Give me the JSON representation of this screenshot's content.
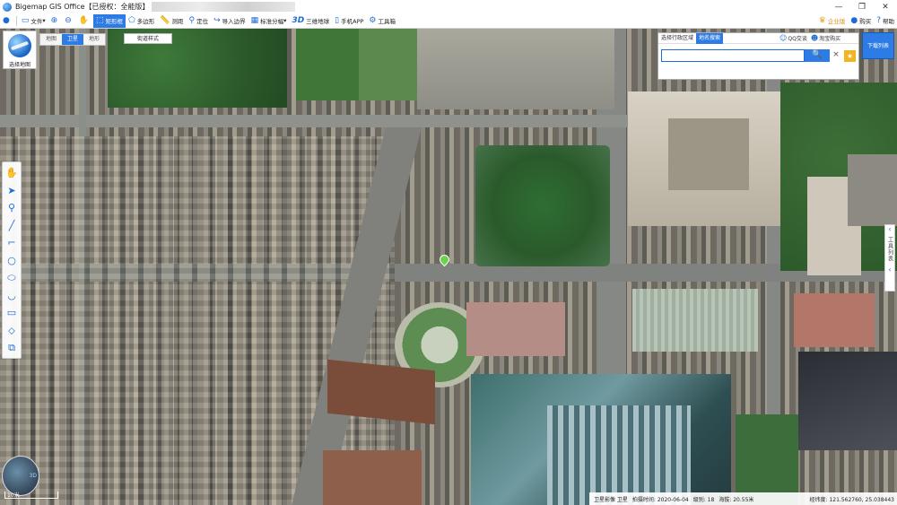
{
  "window": {
    "title": "Bigemap GIS Office【已授权：全能版】",
    "controls": [
      "—",
      "❐",
      "✕"
    ]
  },
  "toolbar": {
    "file_label": "文件",
    "rect_label": "矩形框",
    "polygon_label": "多边形",
    "measure_label": "测距",
    "locate_label": "定位",
    "import_boundary_label": "导入边界",
    "grid_label": "标准分幅",
    "three_d_label": "三维地球",
    "mobile_label": "手机APP",
    "toolbox_label": "工具箱",
    "enterprise_label": "企业版",
    "buy_label": "购买",
    "help_label": "帮助"
  },
  "map_panel": {
    "select_map_label": "选择地图",
    "tabs": [
      "地图",
      "卫星",
      "地形"
    ],
    "street_style_label": "街道样式"
  },
  "search": {
    "tab_region": "选择行政区域",
    "tab_place": "地名搜索",
    "qq_label": "QQ交谈",
    "taobao_label": "淘宝购买",
    "value": "",
    "placeholder": "",
    "clear": "×",
    "search_icon": "🔍"
  },
  "download_list_label": "下载列表",
  "tool_list_label": "工具列表",
  "minimap": {
    "label_3d": "3D"
  },
  "scale": {
    "label": "10米"
  },
  "status": {
    "source": "卫星影像 卫星",
    "date": "拍摄时间: 2020-06-04",
    "level": "级别: 18",
    "altitude": "海拔: 20.55米",
    "coords": "经纬度: 121.562760, 25.038443"
  },
  "colors": {
    "accent": "#2d7be5",
    "star": "#f1b521",
    "gps_pin": "#6ad34a"
  },
  "icons": [
    "globe-icon",
    "file-icon",
    "zoom-in-icon",
    "zoom-out-icon",
    "hand-icon",
    "rect-icon",
    "polygon-icon",
    "ruler-icon",
    "location-icon",
    "import-icon",
    "grid-icon",
    "three-d-icon",
    "mobile-icon",
    "gear-icon",
    "crown-icon",
    "help-icon",
    "search-icon",
    "star-icon",
    "qq-icon",
    "taobao-icon"
  ]
}
